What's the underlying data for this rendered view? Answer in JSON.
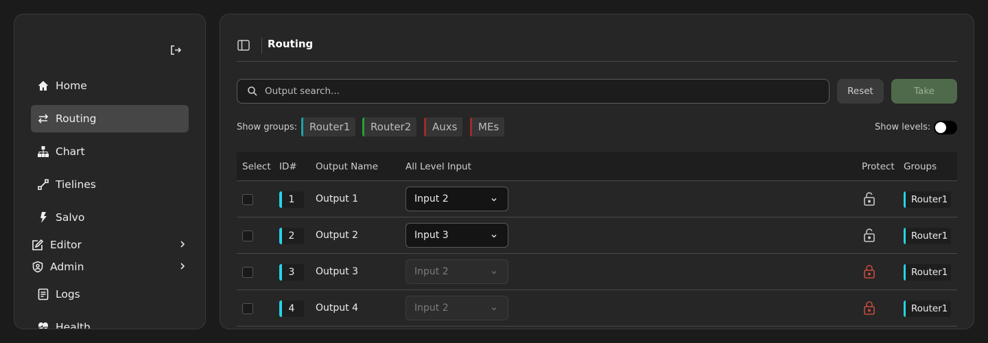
{
  "sidebar": {
    "items": [
      {
        "label": "Home",
        "icon": "home-icon"
      },
      {
        "label": "Routing",
        "icon": "swap-arrows-icon",
        "active": true
      },
      {
        "label": "Chart",
        "icon": "hierarchy-icon"
      },
      {
        "label": "Tielines",
        "icon": "diagonal-link-icon"
      },
      {
        "label": "Salvo",
        "icon": "lightning-icon"
      },
      {
        "label": "Editor",
        "icon": "edit-square-icon",
        "has_submenu": true
      },
      {
        "label": "Admin",
        "icon": "shield-user-icon",
        "has_submenu": true
      },
      {
        "label": "Logs",
        "icon": "document-lines-icon"
      },
      {
        "label": "Health",
        "icon": "heart-pulse-icon"
      }
    ]
  },
  "header": {
    "title": "Routing"
  },
  "search": {
    "placeholder": "Output search..."
  },
  "buttons": {
    "reset": "Reset",
    "take": "Take"
  },
  "groups": {
    "label": "Show groups:",
    "chips": [
      {
        "label": "Router1",
        "color": "#1fa3a8"
      },
      {
        "label": "Router2",
        "color": "#22a33a"
      },
      {
        "label": "Auxs",
        "color": "#a02a2a"
      },
      {
        "label": "MEs",
        "color": "#a02a2a"
      }
    ]
  },
  "levels": {
    "label": "Show levels:",
    "enabled": false
  },
  "table": {
    "columns": [
      "Select",
      "ID#",
      "Output Name",
      "All Level Input",
      "Protect",
      "Groups"
    ],
    "rows": [
      {
        "id": "1",
        "name": "Output 1",
        "input": "Input 2",
        "locked": false,
        "group": "Router1"
      },
      {
        "id": "2",
        "name": "Output 2",
        "input": "Input 3",
        "locked": false,
        "group": "Router1"
      },
      {
        "id": "3",
        "name": "Output 3",
        "input": "Input 2",
        "locked": true,
        "group": "Router1"
      },
      {
        "id": "4",
        "name": "Output 4",
        "input": "Input 2",
        "locked": true,
        "group": "Router1"
      }
    ]
  },
  "colors": {
    "accent_cyan": "#29d3e8",
    "lock_red": "#c84a3e",
    "take_green": "#4f6a4a"
  }
}
